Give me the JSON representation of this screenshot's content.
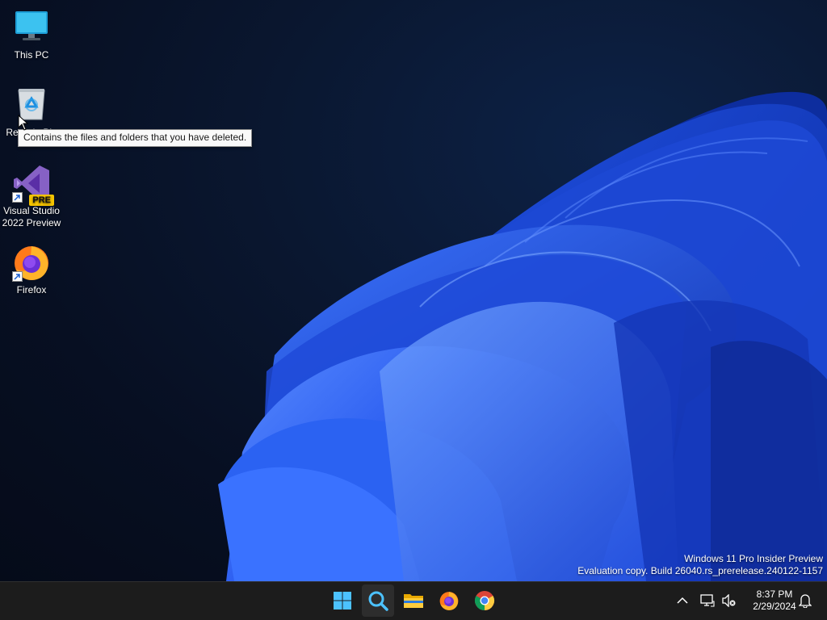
{
  "desktop": {
    "icons": [
      {
        "label": "This PC",
        "icon": "monitor-icon"
      },
      {
        "label": "Recycle Bin",
        "icon": "recycle-bin-icon"
      },
      {
        "label": "Visual Studio 2022 Preview",
        "icon": "visual-studio-icon",
        "badge": "PRE"
      },
      {
        "label": "Firefox",
        "icon": "firefox-icon"
      }
    ],
    "tooltip": "Contains the files and folders that you have deleted.",
    "watermark": {
      "line1": "Windows 11 Pro Insider Preview",
      "line2": "Evaluation copy. Build 26040.rs_prerelease.240122-1157"
    }
  },
  "taskbar": {
    "apps": [
      {
        "name": "Start",
        "icon": "windows-logo-icon"
      },
      {
        "name": "Search",
        "icon": "search-icon",
        "active": true
      },
      {
        "name": "File Explorer",
        "icon": "folder-icon"
      },
      {
        "name": "Firefox",
        "icon": "firefox-icon"
      },
      {
        "name": "Chrome",
        "icon": "chrome-icon"
      }
    ],
    "tray": {
      "icons": [
        "chevron-up-icon",
        "network-icon",
        "volume-muted-icon",
        "notification-bell-icon"
      ],
      "time": "8:37 PM",
      "date": "2/29/2024"
    }
  },
  "colors": {
    "accent": "#2f6bff",
    "taskbar_bg": "#1c1c1c",
    "desktop_bg": "#0a1730"
  }
}
